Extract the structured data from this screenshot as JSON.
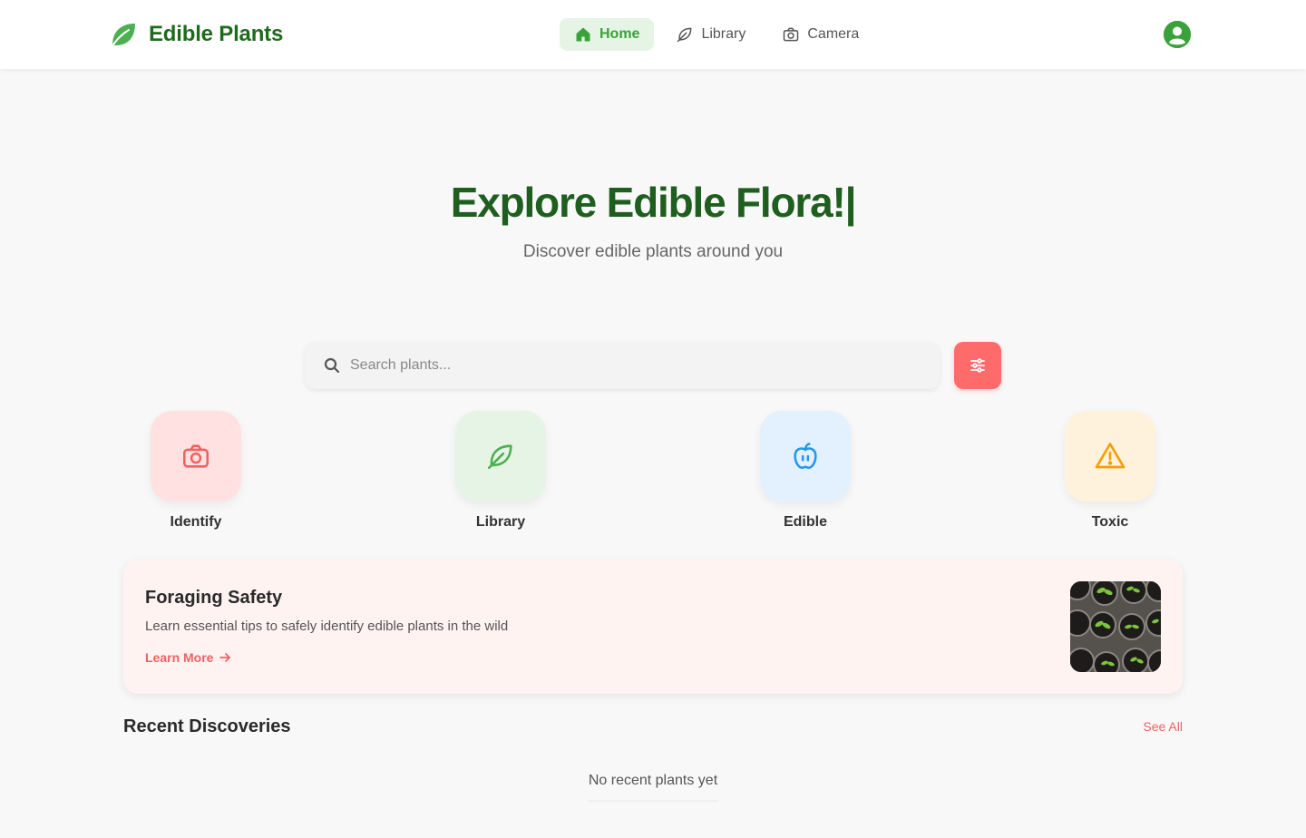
{
  "brand": {
    "name": "Edible Plants"
  },
  "nav": {
    "items": [
      {
        "label": "Home",
        "icon": "home-icon",
        "active": true
      },
      {
        "label": "Library",
        "icon": "leaf-icon",
        "active": false
      },
      {
        "label": "Camera",
        "icon": "camera-icon",
        "active": false
      }
    ]
  },
  "hero": {
    "title": "Explore Edible Flora!|",
    "subtitle": "Discover edible plants around you"
  },
  "search": {
    "placeholder": "Search plants...",
    "value": ""
  },
  "quick_actions": [
    {
      "label": "Identify",
      "icon": "camera-icon",
      "bg": "#ffe1e1",
      "color": "#f06262"
    },
    {
      "label": "Library",
      "icon": "leaf-icon",
      "bg": "#e6f4e6",
      "color": "#4caf50"
    },
    {
      "label": "Edible",
      "icon": "apple-icon",
      "bg": "#e3f0fd",
      "color": "#2196f3"
    },
    {
      "label": "Toxic",
      "icon": "warning-icon",
      "bg": "#fff2dc",
      "color": "#f59e0b"
    }
  ],
  "safety_card": {
    "title": "Foraging Safety",
    "description": "Learn essential tips to safely identify edible plants in the wild",
    "link": "Learn More"
  },
  "recent": {
    "title": "Recent Discoveries",
    "see_all": "See All",
    "empty": "No recent plants yet"
  },
  "colors": {
    "brand_green": "#1e6b1e",
    "accent_green": "#3aa23a",
    "accent_red": "#ff6b6b"
  }
}
